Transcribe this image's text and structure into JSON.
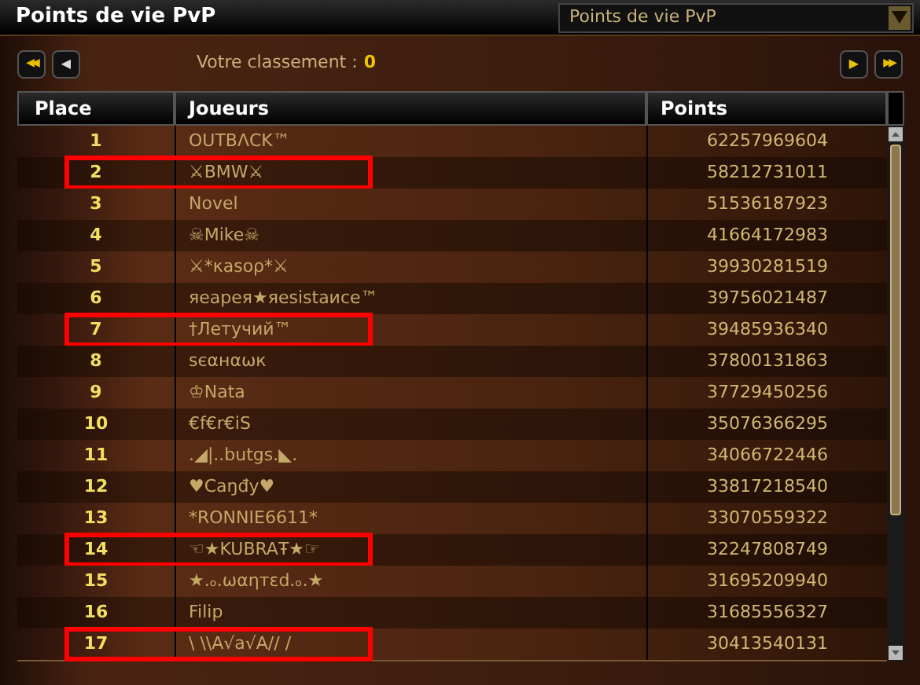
{
  "window": {
    "title": "Points de vie PvP"
  },
  "dropdown": {
    "value": "Points de vie PvP"
  },
  "nav": {
    "first": "◀◀",
    "prev": "◀",
    "next": "▶",
    "last": "▶▶",
    "rank_label": "Votre classement :",
    "rank_value": "0"
  },
  "table": {
    "columns": [
      "Place",
      "Joueurs",
      "Points"
    ],
    "rows": [
      {
        "place": "1",
        "player": "OUTBΛCK™",
        "points": "62257969604",
        "highlighted": false
      },
      {
        "place": "2",
        "player": "⚔BMW⚔",
        "points": "58212731011",
        "highlighted": true
      },
      {
        "place": "3",
        "player": "Novel",
        "points": "51536187923",
        "highlighted": false
      },
      {
        "place": "4",
        "player": "☠Mike☠",
        "points": "41664172983",
        "highlighted": false
      },
      {
        "place": "5",
        "player": "⚔*κasoρ*⚔",
        "points": "39930281519",
        "highlighted": false
      },
      {
        "place": "6",
        "player": "яeapeя★яesistaиce™",
        "points": "39756021487",
        "highlighted": false
      },
      {
        "place": "7",
        "player": "†Летучий™",
        "points": "39485936340",
        "highlighted": true
      },
      {
        "place": "8",
        "player": "ѕєαнαωк",
        "points": "37800131863",
        "highlighted": false
      },
      {
        "place": "9",
        "player": "♔Nata",
        "points": "37729450256",
        "highlighted": false
      },
      {
        "place": "10",
        "player": "€f€r€iS",
        "points": "35076366295",
        "highlighted": false
      },
      {
        "place": "11",
        "player": ".◢|..butgs.◣.",
        "points": "34066722446",
        "highlighted": false
      },
      {
        "place": "12",
        "player": "♥Caŋđy♥",
        "points": "33817218540",
        "highlighted": false
      },
      {
        "place": "13",
        "player": "*RONNIE6611*",
        "points": "33070559322",
        "highlighted": false
      },
      {
        "place": "14",
        "player": "☜★KUBRAŦ★☞",
        "points": "32247808749",
        "highlighted": true
      },
      {
        "place": "15",
        "player": "★.ₒ.ωαηтεd.ₒ.★",
        "points": "31695209940",
        "highlighted": false
      },
      {
        "place": "16",
        "player": "Filip",
        "points": "31685556327",
        "highlighted": false
      },
      {
        "place": "17",
        "player": "\\ \\\\A√a√A// /",
        "points": "30413540131",
        "highlighted": true
      }
    ]
  }
}
